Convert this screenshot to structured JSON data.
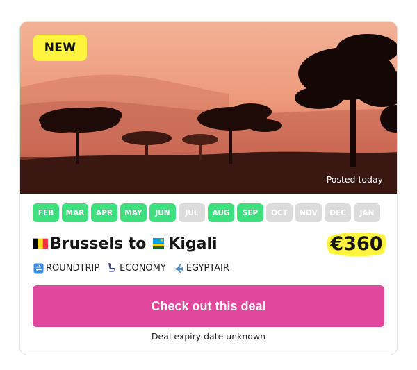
{
  "badge": "NEW",
  "posted": "Posted today",
  "months": [
    {
      "label": "FEB",
      "active": true
    },
    {
      "label": "MAR",
      "active": true
    },
    {
      "label": "APR",
      "active": true
    },
    {
      "label": "MAY",
      "active": true
    },
    {
      "label": "JUN",
      "active": true
    },
    {
      "label": "JUL",
      "active": false
    },
    {
      "label": "AUG",
      "active": true
    },
    {
      "label": "SEP",
      "active": true
    },
    {
      "label": "OCT",
      "active": false
    },
    {
      "label": "NOV",
      "active": false
    },
    {
      "label": "DEC",
      "active": false
    },
    {
      "label": "JAN",
      "active": false
    }
  ],
  "route": {
    "origin": "Brussels to",
    "origin_flag": "belgium-flag",
    "destination": "Kigali",
    "destination_flag": "rwanda-flag"
  },
  "price": "€360",
  "meta": {
    "trip_type": "ROUNDTRIP",
    "cabin": "ECONOMY",
    "airline": "EGYPTAIR"
  },
  "cta_label": "Check out this deal",
  "expiry": "Deal expiry date unknown",
  "colors": {
    "active_month": "#3ddf7f",
    "inactive_month": "#dcdcdc",
    "cta": "#e0479d",
    "badge": "#fff43d",
    "price_highlight": "#fff43d"
  }
}
